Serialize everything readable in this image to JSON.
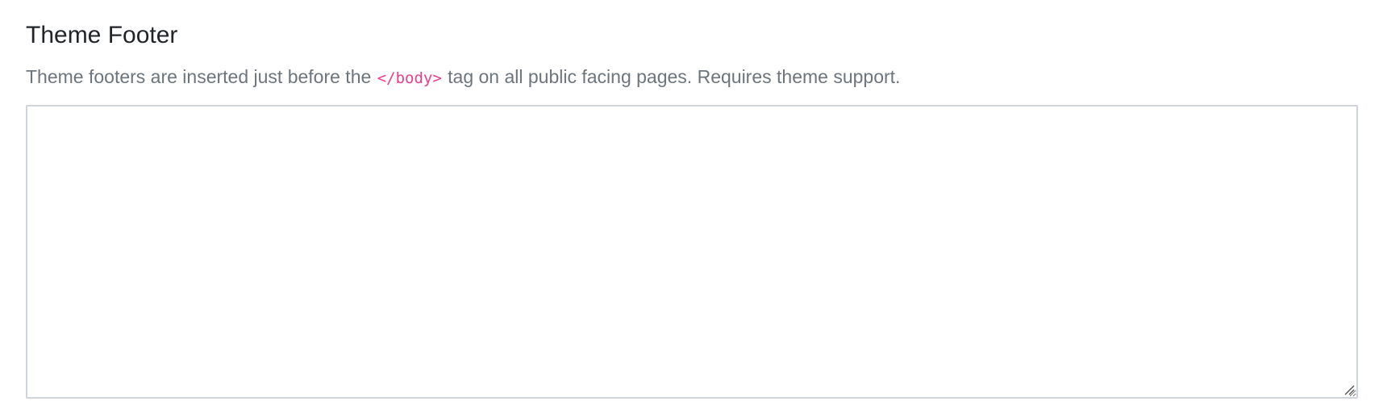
{
  "theme_footer": {
    "title": "Theme Footer",
    "help_before_code": "Theme footers are inserted just before the ",
    "help_code": "</body>",
    "help_after_code": " tag on all public facing pages. Requires theme support.",
    "textarea_value": "",
    "textarea_placeholder": "",
    "resize_icon": "resize-grip-icon"
  }
}
